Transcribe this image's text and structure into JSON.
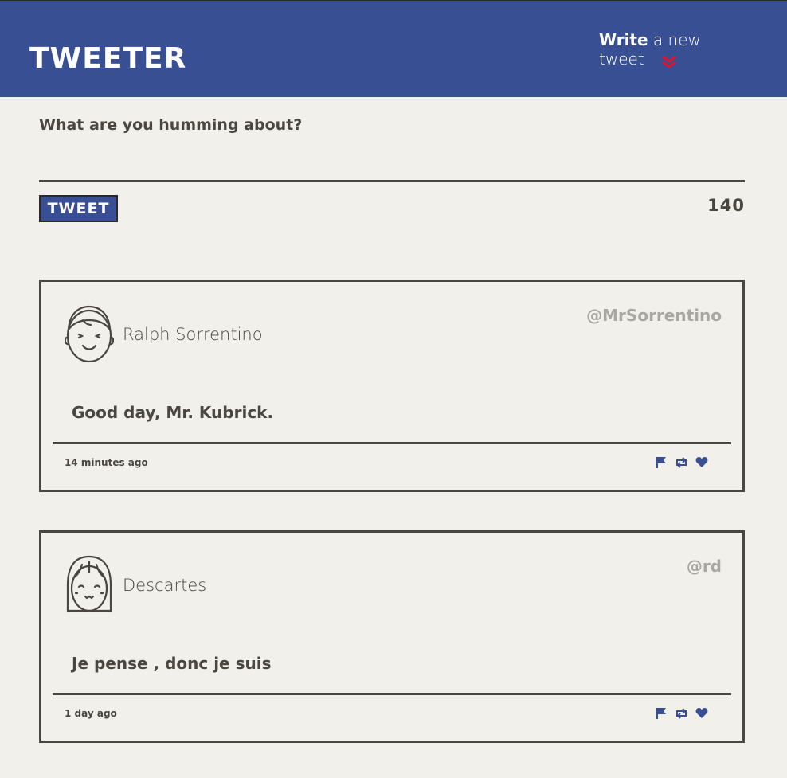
{
  "colors": {
    "navbar": "#384f94",
    "background": "#f2f0eb",
    "text": "#4a4640",
    "handle": "#a9a7a2",
    "accent_red": "#e0142c",
    "icon_blue": "#384f94"
  },
  "nav": {
    "brand": "Tweeter",
    "compose_bold": "Write",
    "compose_rest": " a new tweet",
    "compose_icon": "double-chevron-down-icon"
  },
  "composer": {
    "prompt": "What are you humming about?",
    "textarea_value": "",
    "button_label": "Tweet",
    "counter": "140"
  },
  "tweets": [
    {
      "name": "Ralph Sorrentino",
      "handle": "@MrSorrentino",
      "content": "Good day, Mr. Kubrick.",
      "timestamp": "14 minutes ago",
      "avatar_icon": "male-face-avatar-icon",
      "actions": [
        "flag-icon",
        "retweet-icon",
        "heart-icon"
      ]
    },
    {
      "name": "Descartes",
      "handle": "@rd",
      "content": "Je pense , donc je suis",
      "timestamp": "1 day ago",
      "avatar_icon": "female-face-avatar-icon",
      "actions": [
        "flag-icon",
        "retweet-icon",
        "heart-icon"
      ]
    }
  ]
}
